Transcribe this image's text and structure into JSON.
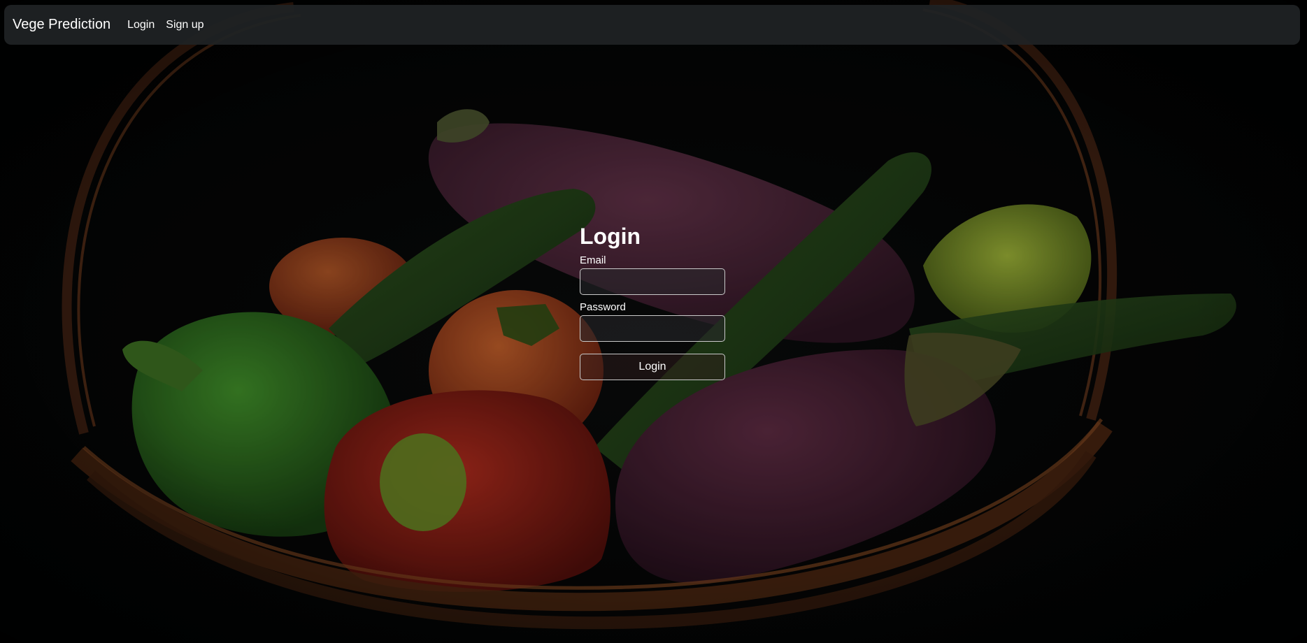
{
  "navbar": {
    "brand": "Vege Prediction",
    "links": [
      "Login",
      "Sign up"
    ]
  },
  "form": {
    "title": "Login",
    "email_label": "Email",
    "email_value": "",
    "password_label": "Password",
    "password_value": "",
    "submit_label": "Login"
  },
  "background": {
    "description_free": true,
    "colors": {
      "base": "#030404",
      "navbar": "#202325",
      "eggplant": "#4a2436",
      "tomato": "#a8451e",
      "red_pepper": "#8e1e16",
      "green_pepper": "#2e6a1e",
      "cucumber": "#1f3c16",
      "lettuce": "#7f9a2a",
      "basket": "#5a2e18"
    }
  }
}
